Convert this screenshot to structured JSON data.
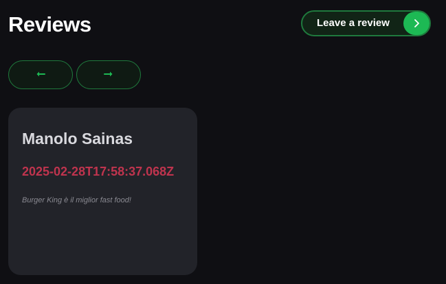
{
  "header": {
    "title": "Reviews",
    "leave_review_label": "Leave a review",
    "leave_review_icon": "chevron-right-icon"
  },
  "nav": {
    "prev_icon": "arrow-left-icon",
    "next_icon": "arrow-right-icon"
  },
  "reviews": [
    {
      "name": "Manolo Sainas",
      "date": "2025-02-28T17:58:37.068Z",
      "text": "Burger King è il miglior fast food!"
    }
  ],
  "colors": {
    "background": "#0f0f13",
    "accent_green": "#1db954",
    "card_background": "#222329",
    "date_red": "#c0344e"
  }
}
